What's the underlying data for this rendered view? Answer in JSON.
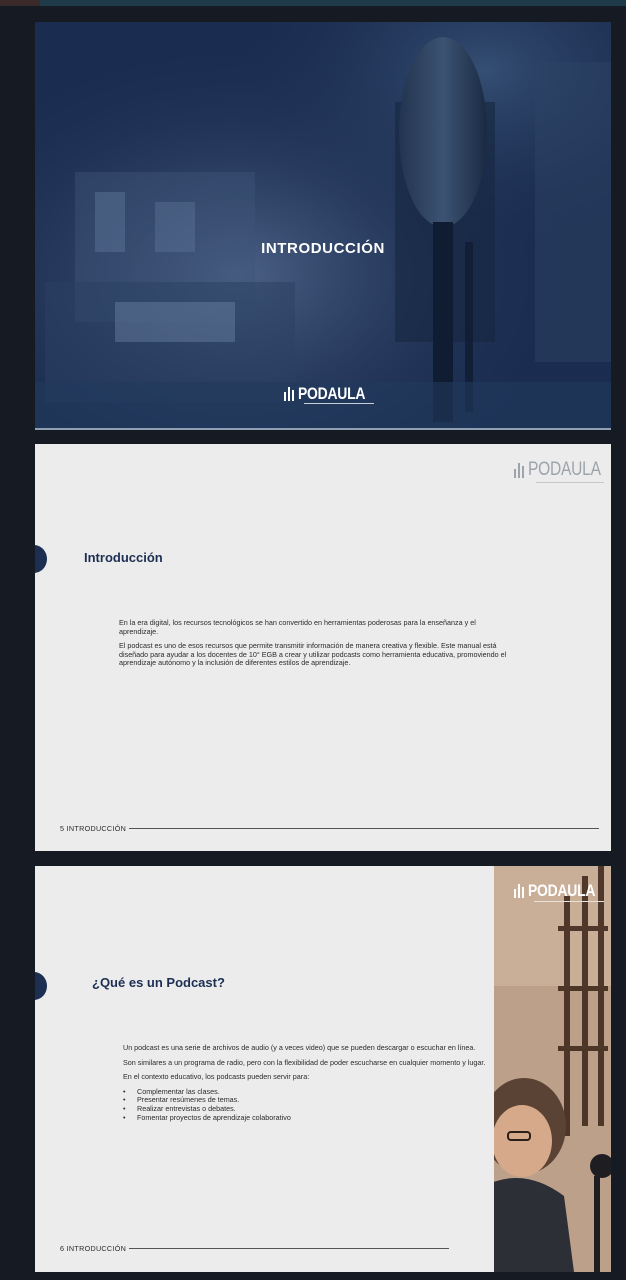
{
  "slides": {
    "cover": {
      "title": "INTRODUCCIÓN",
      "logo_text": "PODAULA"
    },
    "intro": {
      "logo_text": "PODAULA",
      "title": "Introducción",
      "paragraphs": [
        "En la era digital, los recursos tecnológicos se han convertido en herramientas poderosas para la enseñanza y el aprendizaje.",
        "El podcast es uno de esos recursos que permite transmitir información de manera creativa y flexible. Este manual está diseñado para ayudar a los docentes de 10° EGB a crear y utilizar podcasts como herramienta educativa, promoviendo el aprendizaje autónomo y la inclusión de diferentes estilos de aprendizaje."
      ],
      "footer": "5 INTRODUCCIÓN"
    },
    "podcast": {
      "logo_text": "PODAULA",
      "title": "¿Qué es un Podcast?",
      "paragraphs": [
        "Un podcast es una serie de archivos de audio (y a veces video) que se pueden descargar o escuchar en línea.",
        "Son similares a un programa de radio, pero con la flexibilidad de poder escucharse en cualquier momento y lugar.",
        "En el contexto educativo, los podcasts pueden servir para:"
      ],
      "bullets": [
        "Complementar las clases.",
        "Presentar resúmenes de temas.",
        "Realizar entrevistas o debates.",
        "Fomentar proyectos de aprendizaje colaborativo"
      ],
      "footer": "6 INTRODUCCIÓN"
    }
  },
  "colors": {
    "navy": "#1c2f52",
    "page_bg": "#ececec",
    "viewer_bg": "#161a22"
  },
  "icons": {
    "logo": "bar-chart-logo-icon",
    "marker": "half-circle-marker"
  }
}
